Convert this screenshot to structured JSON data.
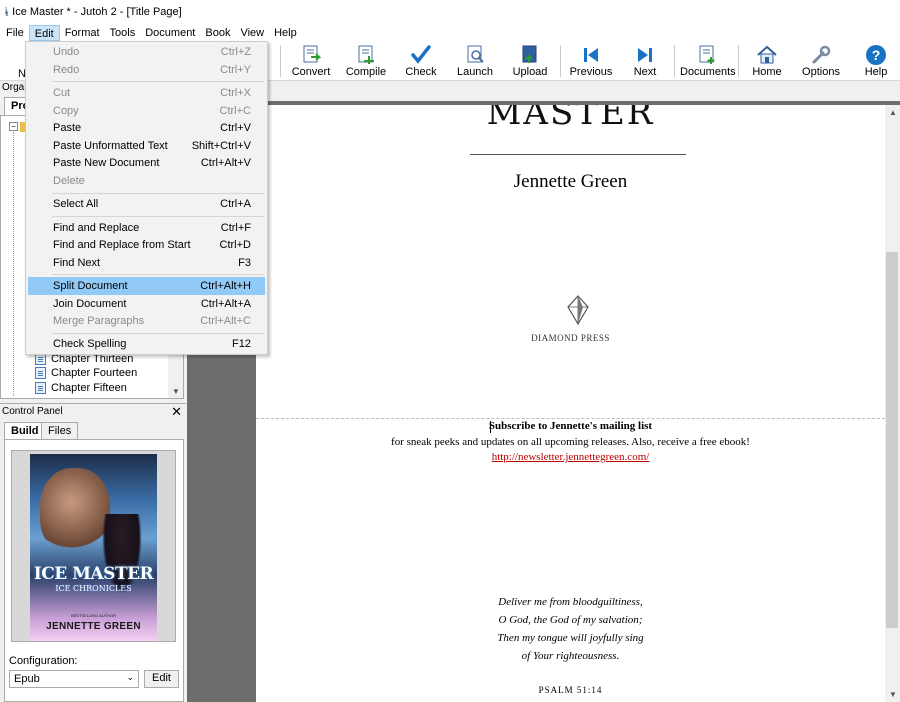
{
  "window": {
    "icon_text": "ʲⱼ",
    "title": "Ice Master * - Jutoh 2 - [Title Page]"
  },
  "menubar": [
    "File",
    "Edit",
    "Format",
    "Tools",
    "Document",
    "Book",
    "View",
    "Help"
  ],
  "toolbar": {
    "partial_label": "N",
    "buttons": [
      "Convert",
      "Compile",
      "Check",
      "Launch",
      "Upload",
      "Previous",
      "Next",
      "Documents",
      "Home",
      "Options",
      "Help"
    ]
  },
  "organizer": {
    "title": "Organ",
    "tab": "Pro",
    "tree_items": [
      "Chapter Thirteen",
      "Chapter Fourteen",
      "Chapter Fifteen"
    ]
  },
  "control_panel": {
    "title": "Control Panel",
    "close": "✕",
    "tabs": [
      "Build",
      "Files"
    ],
    "cover": {
      "title": "ICE MASTER",
      "subtitle": "ICE CHRONICLES",
      "author": "JENNETTE GREEN",
      "tagline": "BESTSELLING AUTHOR"
    },
    "config_label": "Configuration:",
    "config_value": "Epub",
    "edit_button": "Edit"
  },
  "edit_menu": [
    {
      "label": "Undo",
      "shortcut": "Ctrl+Z",
      "disabled": true
    },
    {
      "label": "Redo",
      "shortcut": "Ctrl+Y",
      "disabled": true
    },
    {
      "sep": true
    },
    {
      "label": "Cut",
      "shortcut": "Ctrl+X",
      "disabled": true
    },
    {
      "label": "Copy",
      "shortcut": "Ctrl+C",
      "disabled": true
    },
    {
      "label": "Paste",
      "shortcut": "Ctrl+V"
    },
    {
      "label": "Paste Unformatted Text",
      "shortcut": "Shift+Ctrl+V"
    },
    {
      "label": "Paste New Document",
      "shortcut": "Ctrl+Alt+V"
    },
    {
      "label": "Delete",
      "shortcut": "",
      "disabled": true
    },
    {
      "sep": true
    },
    {
      "label": "Select All",
      "shortcut": "Ctrl+A"
    },
    {
      "sep": true
    },
    {
      "label": "Find and Replace",
      "shortcut": "Ctrl+F"
    },
    {
      "label": "Find and Replace from Start",
      "shortcut": "Ctrl+D"
    },
    {
      "label": "Find Next",
      "shortcut": "F3"
    },
    {
      "sep": true
    },
    {
      "label": "Split Document",
      "shortcut": "Ctrl+Alt+H",
      "selected": true
    },
    {
      "label": "Join Document",
      "shortcut": "Ctrl+Alt+A"
    },
    {
      "label": "Merge Paragraphs",
      "shortcut": "Ctrl+Alt+C",
      "disabled": true
    },
    {
      "sep": true
    },
    {
      "label": "Check Spelling",
      "shortcut": "F12"
    }
  ],
  "editor": {
    "title_fragment": "MASTER",
    "author": "Jennette Green",
    "publisher": "DIAMOND PRESS",
    "subscribe": "Subscribe to Jennette's mailing list",
    "sneak_peek": "for sneak peeks and updates on all upcoming releases. Also, receive a free ebook!",
    "newsletter_url": "http://newsletter.jennettegreen.com/",
    "psalm": [
      "Deliver me from bloodguiltiness,",
      "O God, the God of my salvation;",
      "Then my tongue will joyfully sing",
      "of Your righteousness."
    ],
    "psalm_ref": "PSALM 51:14"
  },
  "colors": {
    "accent": "#1a72c4",
    "selection": "#91c9f7",
    "link": "#b00000"
  }
}
